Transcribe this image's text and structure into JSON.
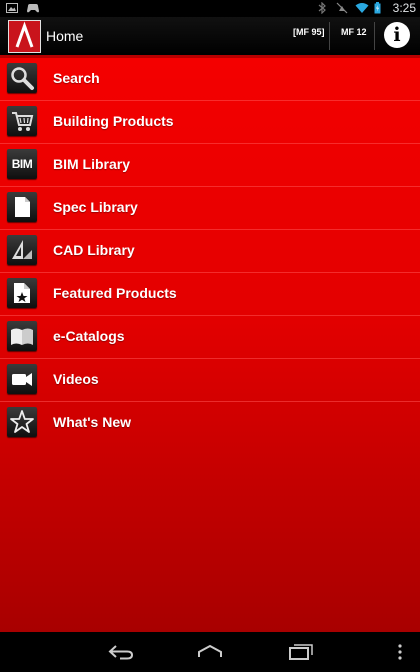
{
  "status_bar": {
    "time": "3:25",
    "icons": [
      "photo-icon",
      "game-controller-icon",
      "bluetooth-icon",
      "no-alarm-icon",
      "wifi-icon",
      "battery-icon"
    ]
  },
  "action_bar": {
    "title": "Home",
    "btn_mf95": "[MF 95]",
    "btn_mf12": "MF 12",
    "info_symbol": "i"
  },
  "menu": {
    "items": [
      {
        "label": "Search",
        "icon": "search-icon"
      },
      {
        "label": "Building Products",
        "icon": "cart-icon"
      },
      {
        "label": "BIM Library",
        "icon": "bim-icon",
        "icon_text": "BIM"
      },
      {
        "label": "Spec Library",
        "icon": "document-icon"
      },
      {
        "label": "CAD Library",
        "icon": "drafting-icon"
      },
      {
        "label": "Featured Products",
        "icon": "featured-doc-icon"
      },
      {
        "label": "e-Catalogs",
        "icon": "book-icon"
      },
      {
        "label": "Videos",
        "icon": "video-camera-icon"
      },
      {
        "label": "What's New",
        "icon": "star-icon"
      }
    ]
  },
  "colors": {
    "accent": "#e60000",
    "background_top": "#f40000",
    "background_bottom": "#a80000",
    "bar": "#000000"
  }
}
